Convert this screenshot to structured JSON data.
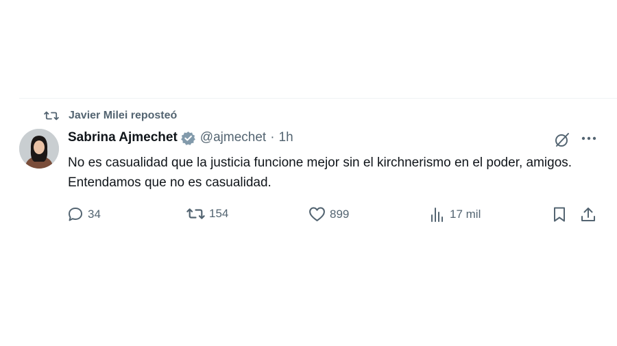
{
  "repost": {
    "text": "Javier Milei reposteó",
    "icon": "repost-icon"
  },
  "author": {
    "name": "Sabrina Ajmechet",
    "handle": "@ajmechet",
    "separator": "·",
    "time": "1h",
    "verified_icon": "verified-badge-icon"
  },
  "tweet": {
    "text": "No es casualidad que la justicia funcione mejor sin el kirchnerismo en el poder, amigos. Entendamos que no es casualidad."
  },
  "actions": {
    "replies": "34",
    "reposts": "154",
    "likes": "899",
    "views": "17 mil"
  },
  "colors": {
    "text_primary": "#0f1419",
    "text_secondary": "#536471",
    "verified_badge": "#829aab"
  }
}
